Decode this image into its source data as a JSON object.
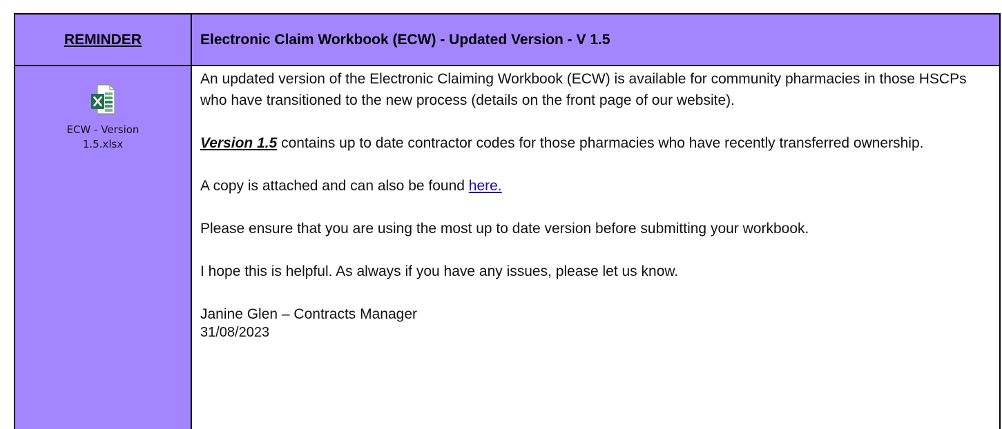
{
  "header": {
    "left_label": "REMINDER",
    "title": "Electronic Claim Workbook (ECW) - Updated Version - V 1.5"
  },
  "attachment": {
    "icon": "excel-file-icon",
    "filename_line1": "ECW - Version",
    "filename_line2": "1.5.xlsx"
  },
  "body": {
    "para1": "An updated version of the Electronic Claiming Workbook (ECW) is available for community pharmacies in those HSCPs who have transitioned to the new process (details on the front page of our website).",
    "para2_emphasis": "Version 1.5",
    "para2_rest": " contains up to date contractor codes for those pharmacies who have recently transferred ownership.",
    "para3_text": "A copy is attached and can also be found ",
    "para3_link": "here.",
    "para4": "Please ensure that you are using the most up to date version before submitting your workbook.",
    "para5": "I hope this is helpful.  As always if you have any issues, please let us know.",
    "signature": "Janine Glen – Contracts Manager",
    "date": "31/08/2023"
  },
  "colors": {
    "header_bg": "#a385ff",
    "link": "#1a0dab",
    "excel_green": "#1e7145"
  }
}
